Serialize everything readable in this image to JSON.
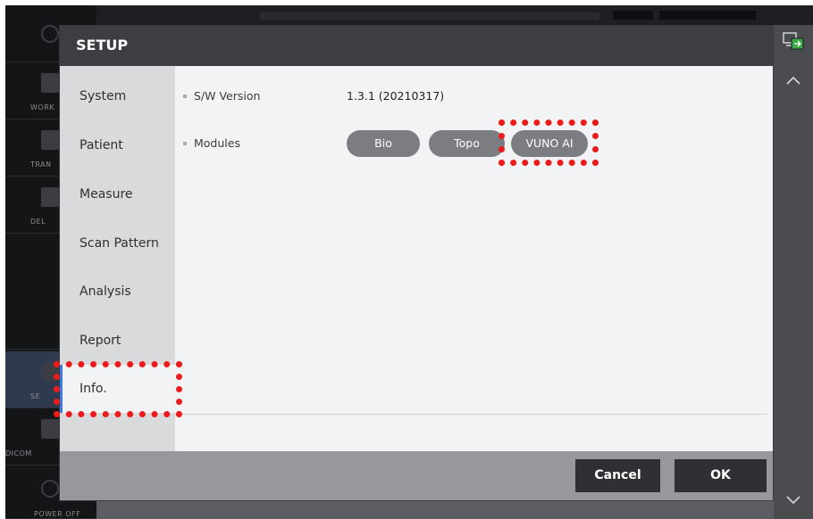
{
  "background_app": {
    "left_buttons": [
      {
        "label": "WORK"
      },
      {
        "label": "TRAN"
      },
      {
        "label": "DEL"
      },
      {
        "label": "SE"
      },
      {
        "label": "DICOM"
      },
      {
        "label": "POWER OFF"
      }
    ]
  },
  "modal": {
    "title": "SETUP",
    "nav_items": [
      {
        "label": "System"
      },
      {
        "label": "Patient"
      },
      {
        "label": "Measure"
      },
      {
        "label": "Scan Pattern"
      },
      {
        "label": "Analysis"
      },
      {
        "label": "Report"
      },
      {
        "label": "Info."
      }
    ],
    "active_nav": "Info.",
    "info": {
      "version_label": "S/W Version",
      "version_value": "1.3.1 (20210317)",
      "modules_label": "Modules",
      "modules": [
        {
          "label": "Bio"
        },
        {
          "label": "Topo"
        },
        {
          "label": "VUNO AI"
        }
      ]
    },
    "footer": {
      "cancel_label": "Cancel",
      "ok_label": "OK"
    }
  },
  "colors": {
    "highlight": "#ee1b1b",
    "active_indicator": "#3d7de0",
    "header_bg": "#3c3e43",
    "module_pill_bg": "#7b7d83"
  },
  "icons": {
    "scroll_up": "chevron-up-icon",
    "scroll_down": "chevron-down-icon",
    "connection": "monitor-connection-icon"
  }
}
